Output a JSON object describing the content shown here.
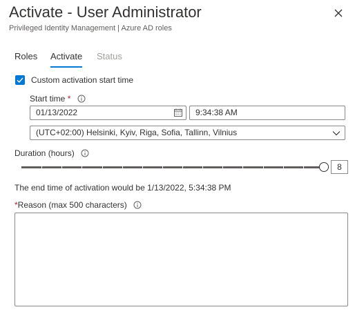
{
  "panel": {
    "title": "Activate - User Administrator",
    "subtitle": "Privileged Identity Management | Azure AD roles",
    "close_icon": "close-icon"
  },
  "tabs": [
    {
      "label": "Roles",
      "state": "normal"
    },
    {
      "label": "Activate",
      "state": "selected"
    },
    {
      "label": "Status",
      "state": "disabled"
    }
  ],
  "custom_start": {
    "label": "Custom activation start time",
    "checked": true
  },
  "start_time": {
    "label": "Start time",
    "required_mark": "*",
    "date_value": "01/13/2022",
    "time_value": "9:34:38 AM",
    "timezone_value": "(UTC+02:00) Helsinki, Kyiv, Riga, Sofia, Tallinn, Vilnius"
  },
  "duration": {
    "label": "Duration (hours)",
    "value": "8",
    "level_fraction": 1.0
  },
  "end_time_text": "The end time of activation would be 1/13/2022, 5:34:38 PM",
  "reason": {
    "required_mark": "*",
    "label": "Reason (max 500 characters)",
    "value": ""
  },
  "colors": {
    "accent": "#0078d4",
    "required": "#a4262c",
    "disabled_text": "#a19f9d"
  }
}
